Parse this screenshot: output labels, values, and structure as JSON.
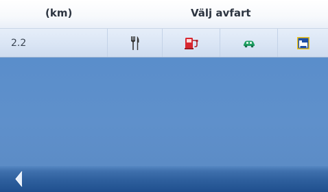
{
  "header": {
    "unit_label": "(km)",
    "title": "Välj avfart"
  },
  "poi_row": {
    "distance": "2.2",
    "icons": [
      {
        "name": "restaurant-icon"
      },
      {
        "name": "fuel-icon"
      },
      {
        "name": "car-service-icon"
      },
      {
        "name": "hotel-icon"
      }
    ]
  },
  "footer": {
    "back_icon": "back-arrow-icon"
  },
  "colors": {
    "content_bg": "#5a8ecb",
    "footer_bg": "#2e5f9d",
    "fuel_red": "#d8262f",
    "car_green": "#1f9e62",
    "hotel_blue": "#1d4ea6",
    "hotel_yellow": "#f2c51a"
  }
}
